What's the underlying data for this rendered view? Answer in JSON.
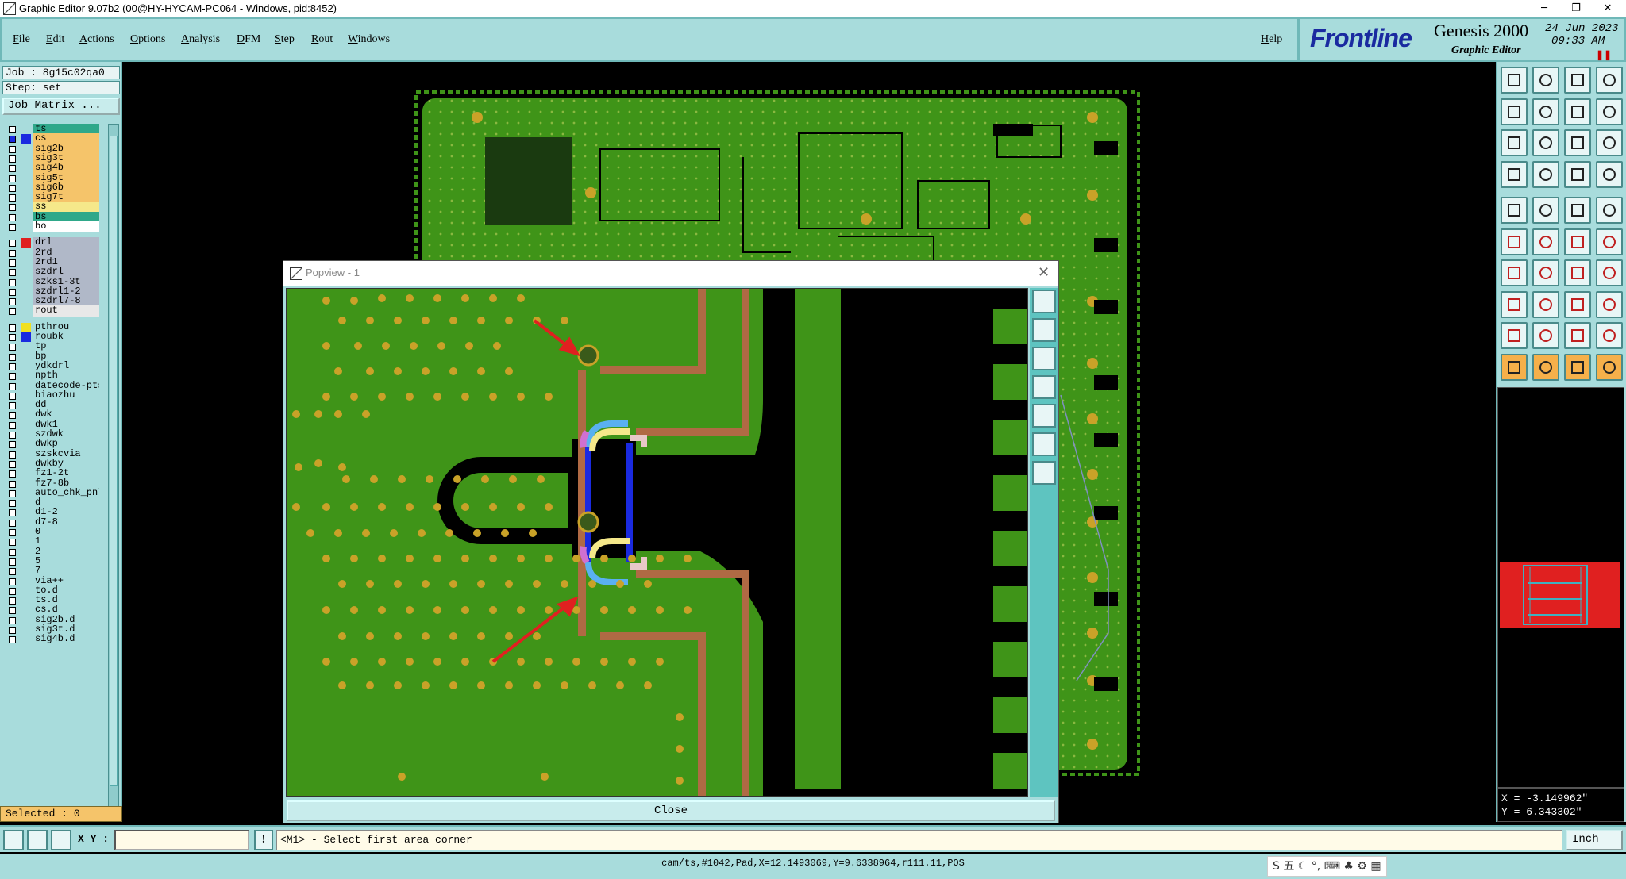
{
  "window": {
    "title": "Graphic Editor 9.07b2 (00@HY-HYCAM-PC064 - Windows, pid:8452)",
    "minimize_glyph": "─",
    "restore_glyph": "❐",
    "close_glyph": "✕"
  },
  "menu": {
    "items": [
      "File",
      "Edit",
      "Actions",
      "Options",
      "Analysis",
      "DFM",
      "Step",
      "Rout",
      "Windows"
    ],
    "help": "Help"
  },
  "brand": {
    "logo": "Frontline",
    "product": "Genesis 2000",
    "subtitle": "Graphic Editor",
    "date": "24 Jun 2023",
    "time": "09:33 AM",
    "pause_glyph": "❚❚"
  },
  "left": {
    "job": "Job : 8g15c02qa0",
    "step": "Step: set",
    "job_matrix": "Job Matrix ...",
    "layers": [
      {
        "name": "ts",
        "swatch": "",
        "bg": "#2fa88a",
        "check": "empty"
      },
      {
        "name": "cs",
        "swatch": "#1a2ae0",
        "bg": "#f5c46a",
        "check": "filled"
      },
      {
        "name": "sig2b",
        "swatch": "",
        "bg": "#f5c46a",
        "check": "empty"
      },
      {
        "name": "sig3t",
        "swatch": "",
        "bg": "#f5c46a",
        "check": "empty"
      },
      {
        "name": "sig4b",
        "swatch": "",
        "bg": "#f5c46a",
        "check": "empty"
      },
      {
        "name": "sig5t",
        "swatch": "",
        "bg": "#f5c46a",
        "check": "empty"
      },
      {
        "name": "sig6b",
        "swatch": "",
        "bg": "#f5c46a",
        "check": "empty"
      },
      {
        "name": "sig7t",
        "swatch": "",
        "bg": "#f5c46a",
        "check": "empty"
      },
      {
        "name": "ss",
        "swatch": "",
        "bg": "#f5e88a",
        "check": "empty"
      },
      {
        "name": "bs",
        "swatch": "",
        "bg": "#2fa88a",
        "check": "empty"
      },
      {
        "name": "bo",
        "swatch": "",
        "bg": "#ffffff",
        "check": "empty"
      },
      {
        "name": "drl",
        "swatch": "#e02020",
        "bg": "#b0b8c8",
        "check": "empty"
      },
      {
        "name": "2rd",
        "swatch": "",
        "bg": "#b0b8c8",
        "check": "empty"
      },
      {
        "name": "2rd1",
        "swatch": "",
        "bg": "#b0b8c8",
        "check": "empty"
      },
      {
        "name": "szdrl",
        "swatch": "",
        "bg": "#b0b8c8",
        "check": "empty"
      },
      {
        "name": "szks1-3t",
        "swatch": "",
        "bg": "#b0b8c8",
        "check": "empty"
      },
      {
        "name": "szdrl1-2",
        "swatch": "",
        "bg": "#b0b8c8",
        "check": "empty"
      },
      {
        "name": "szdrl7-8",
        "swatch": "",
        "bg": "#b0b8c8",
        "check": "empty"
      },
      {
        "name": "rout",
        "swatch": "",
        "bg": "#e8e8e8",
        "check": "empty"
      },
      {
        "name": "pthrou",
        "swatch": "#f0e020",
        "bg": "#a8dcdc",
        "check": "empty"
      },
      {
        "name": "roubk",
        "swatch": "#1a2ae0",
        "bg": "#a8dcdc",
        "check": "empty"
      },
      {
        "name": "tp",
        "swatch": "",
        "bg": "#a8dcdc",
        "check": "empty"
      },
      {
        "name": "bp",
        "swatch": "",
        "bg": "#a8dcdc",
        "check": "empty"
      },
      {
        "name": "ydkdrl",
        "swatch": "",
        "bg": "#a8dcdc",
        "check": "empty"
      },
      {
        "name": "npth",
        "swatch": "",
        "bg": "#a8dcdc",
        "check": "empty"
      },
      {
        "name": "datecode-pts",
        "swatch": "",
        "bg": "#a8dcdc",
        "check": "empty"
      },
      {
        "name": "biaozhu",
        "swatch": "",
        "bg": "#a8dcdc",
        "check": "empty"
      },
      {
        "name": "dd",
        "swatch": "",
        "bg": "#a8dcdc",
        "check": "empty"
      },
      {
        "name": "dwk",
        "swatch": "",
        "bg": "#a8dcdc",
        "check": "empty"
      },
      {
        "name": "dwk1",
        "swatch": "",
        "bg": "#a8dcdc",
        "check": "empty"
      },
      {
        "name": "szdwk",
        "swatch": "",
        "bg": "#a8dcdc",
        "check": "empty"
      },
      {
        "name": "dwkp",
        "swatch": "",
        "bg": "#a8dcdc",
        "check": "empty"
      },
      {
        "name": "szskcvia",
        "swatch": "",
        "bg": "#a8dcdc",
        "check": "empty"
      },
      {
        "name": "dwkby",
        "swatch": "",
        "bg": "#a8dcdc",
        "check": "empty"
      },
      {
        "name": "fz1-2t",
        "swatch": "",
        "bg": "#a8dcdc",
        "check": "empty"
      },
      {
        "name": "fz7-8b",
        "swatch": "",
        "bg": "#a8dcdc",
        "check": "empty"
      },
      {
        "name": "auto_chk_pnl",
        "swatch": "",
        "bg": "#a8dcdc",
        "check": "empty"
      },
      {
        "name": "d",
        "swatch": "",
        "bg": "#a8dcdc",
        "check": "empty"
      },
      {
        "name": "d1-2",
        "swatch": "",
        "bg": "#a8dcdc",
        "check": "empty"
      },
      {
        "name": "d7-8",
        "swatch": "",
        "bg": "#a8dcdc",
        "check": "empty"
      },
      {
        "name": "0",
        "swatch": "",
        "bg": "#a8dcdc",
        "check": "empty"
      },
      {
        "name": "1",
        "swatch": "",
        "bg": "#a8dcdc",
        "check": "empty"
      },
      {
        "name": "2",
        "swatch": "",
        "bg": "#a8dcdc",
        "check": "empty"
      },
      {
        "name": "5",
        "swatch": "",
        "bg": "#a8dcdc",
        "check": "empty"
      },
      {
        "name": "7",
        "swatch": "",
        "bg": "#a8dcdc",
        "check": "empty"
      },
      {
        "name": "via++",
        "swatch": "",
        "bg": "#a8dcdc",
        "check": "empty"
      },
      {
        "name": "to.d",
        "swatch": "",
        "bg": "#a8dcdc",
        "check": "empty"
      },
      {
        "name": "ts.d",
        "swatch": "",
        "bg": "#a8dcdc",
        "check": "empty"
      },
      {
        "name": "cs.d",
        "swatch": "",
        "bg": "#a8dcdc",
        "check": "empty"
      },
      {
        "name": "sig2b.d",
        "swatch": "",
        "bg": "#a8dcdc",
        "check": "empty"
      },
      {
        "name": "sig3t.d",
        "swatch": "",
        "bg": "#a8dcdc",
        "check": "empty"
      },
      {
        "name": "sig4b.d",
        "swatch": "",
        "bg": "#a8dcdc",
        "check": "empty"
      }
    ],
    "selected": "Selected : 0"
  },
  "popview": {
    "title": "Popview - 1",
    "close_glyph": "✕",
    "close_label": "Close"
  },
  "coords": {
    "x": "X = -3.149962\"",
    "y": "Y = 6.343302\""
  },
  "cmd": {
    "xy_label": "X Y :",
    "input_value": "",
    "excl": "!",
    "prompt": "<M1> - Select first area corner",
    "units": "Inch"
  },
  "status": {
    "text": "cam/ts,#1042,Pad,X=12.1493069,Y=9.6338964,r111.11,POS",
    "ime": "S 五 ☾ °, ⌨ ♣ ⚙ ▦"
  },
  "colors": {
    "panel": "#a8dcdc",
    "copper": "#3f9418",
    "trace": "#b06a44",
    "pad": "#c9a228",
    "selected_blue": "#1a2ae0",
    "highlight": "#e02020"
  }
}
